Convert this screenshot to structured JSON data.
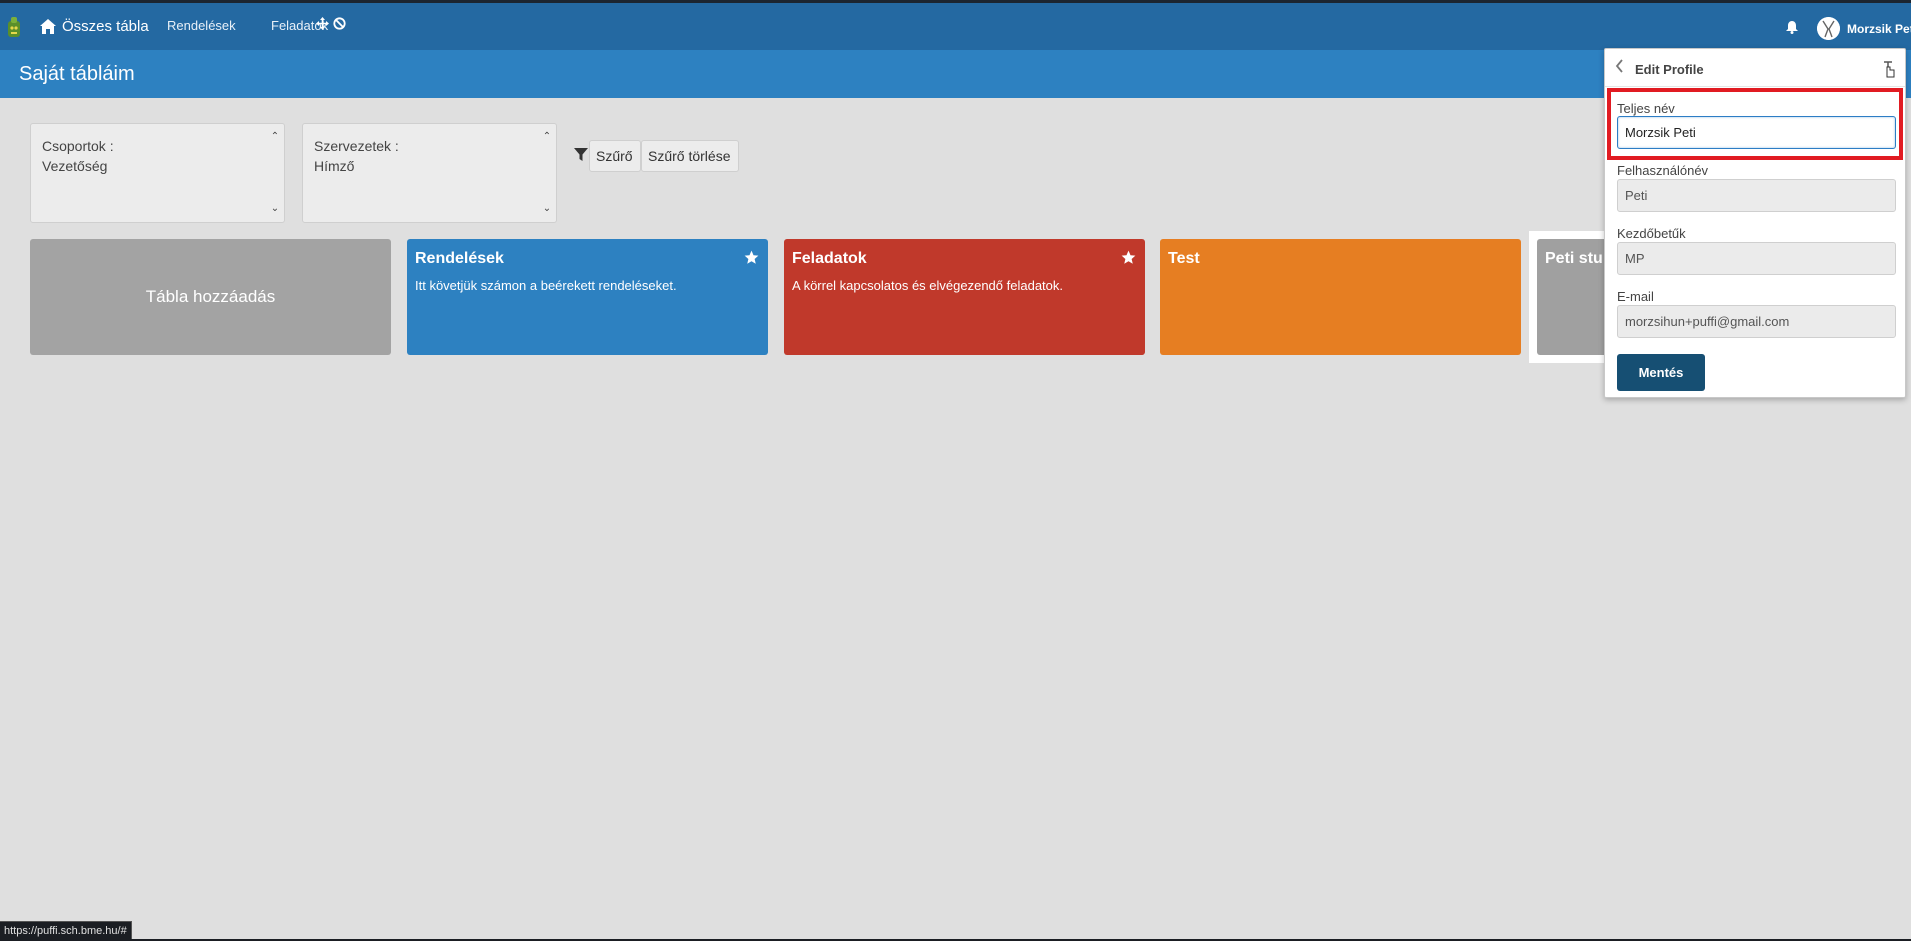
{
  "nav": {
    "home_label": "Összes tábla",
    "links": [
      "Rendelések",
      "Feladatok"
    ],
    "user_name": "Morzsik Peti"
  },
  "page": {
    "title": "Saját tábláim"
  },
  "filters": {
    "groups": {
      "label": "Csoportok :",
      "value": "Vezetőség"
    },
    "orgs": {
      "label": "Szervezetek :",
      "value": "Hímző"
    },
    "filter_button": "Szűrő",
    "clear_button": "Szűrő törlése"
  },
  "boards": {
    "add_label": "Tábla hozzáadás",
    "items": [
      {
        "title": "Rendelések",
        "description": "Itt követjük számon a beérekett rendeléseket.",
        "color": "#2d81c1",
        "starred": true
      },
      {
        "title": "Feladatok",
        "description": "A körrel kapcsolatos és elvégezendő feladatok.",
        "color": "#c0392b",
        "starred": true
      },
      {
        "title": "Test",
        "description": "",
        "color": "#e67e22",
        "starred": false
      },
      {
        "title": "Peti stu",
        "description": "",
        "color": "#a0a0a0",
        "starred": false
      }
    ]
  },
  "profile_panel": {
    "title": "Edit Profile",
    "full_name_label": "Teljes név",
    "full_name_value": "Morzsik Peti",
    "username_label": "Felhasználónév",
    "username_value": "Peti",
    "initials_label": "Kezdőbetűk",
    "initials_value": "MP",
    "email_label": "E-mail",
    "email_value": "morzsihun+puffi@gmail.com",
    "save_label": "Mentés"
  },
  "status_bar": {
    "url": "https://puffi.sch.bme.hu/#"
  },
  "colors": {
    "nav": "#2469a2",
    "subheader": "#2d81c1",
    "save_button": "#164f73",
    "highlight": "#e11b22"
  }
}
